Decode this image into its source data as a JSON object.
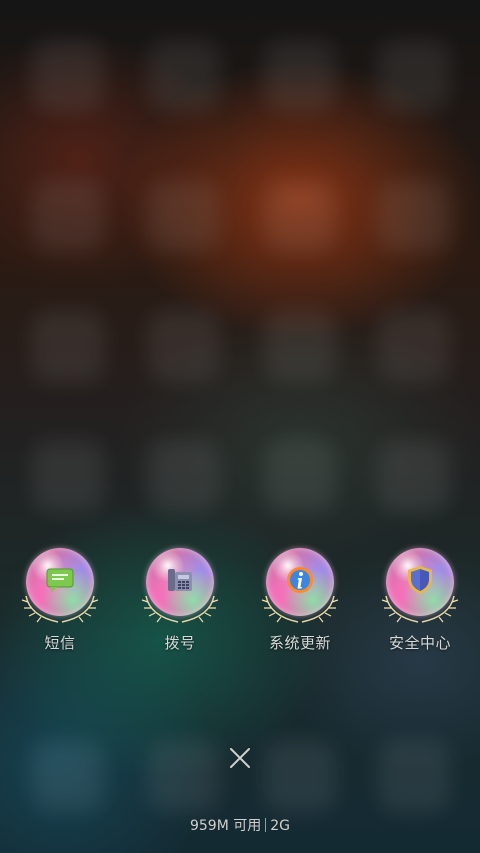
{
  "shortcuts": [
    {
      "label": "短信",
      "icon": "message-icon"
    },
    {
      "label": "拨号",
      "icon": "phone-icon"
    },
    {
      "label": "系统更新",
      "icon": "info-icon"
    },
    {
      "label": "安全中心",
      "icon": "shield-icon"
    }
  ],
  "close": {
    "icon": "close-icon"
  },
  "memory": {
    "available": "959M 可用",
    "network": "2G"
  },
  "colors": {
    "label": "#d8d8d8",
    "memory_text": "#cfcfcf",
    "bubble_pink": "#e070b8"
  }
}
